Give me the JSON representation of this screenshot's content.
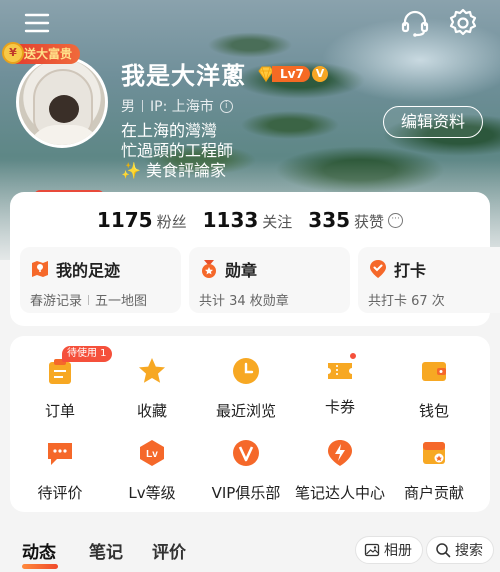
{
  "header": {
    "menu_icon": "menu-icon",
    "service_icon": "headset-icon",
    "settings_icon": "gear-icon"
  },
  "profile": {
    "badge": "送大富贵",
    "name": "我是大洋蔥",
    "level": "Lv7",
    "verified": "V",
    "gender": "男",
    "ip_location": "IP: 上海市",
    "bio": [
      "在上海的灣灣",
      "忙過頭的工程師",
      "✨ 美食評論家"
    ],
    "edit_label": "编辑资料"
  },
  "stats": [
    {
      "value": "1175",
      "label": "粉丝"
    },
    {
      "value": "1133",
      "label": "关注"
    },
    {
      "value": "335",
      "label": "获赞"
    }
  ],
  "features": [
    {
      "title": "我的足迹",
      "sub_a": "春游记录",
      "sub_b": "五一地图",
      "icon": "map-icon"
    },
    {
      "title": "勋章",
      "sub_a": "共计 34 枚勋章",
      "icon": "medal-icon"
    },
    {
      "title": "打卡",
      "sub_a": "共打卡 67 次",
      "icon": "checkin-icon"
    }
  ],
  "menu": [
    {
      "label": "订单",
      "icon": "order-icon",
      "tip": "待使用 1"
    },
    {
      "label": "收藏",
      "icon": "star-icon"
    },
    {
      "label": "最近浏览",
      "icon": "clock-icon"
    },
    {
      "label": "卡券",
      "icon": "coupon-icon"
    },
    {
      "label": "钱包",
      "icon": "wallet-icon"
    },
    {
      "label": "待评价",
      "icon": "comment-icon"
    },
    {
      "label": "Lv等级",
      "icon": "level-icon"
    },
    {
      "label": "VIP俱乐部",
      "icon": "vip-icon"
    },
    {
      "label": "笔记达人中心",
      "icon": "lightning-icon"
    },
    {
      "label": "商户贡献",
      "icon": "shop-icon"
    }
  ],
  "tabs": {
    "items": [
      "动态",
      "笔记",
      "评价"
    ],
    "album": "相册",
    "search": "搜索"
  },
  "colors": {
    "accent": "#f5682a",
    "badge_red": "#f5503b"
  }
}
